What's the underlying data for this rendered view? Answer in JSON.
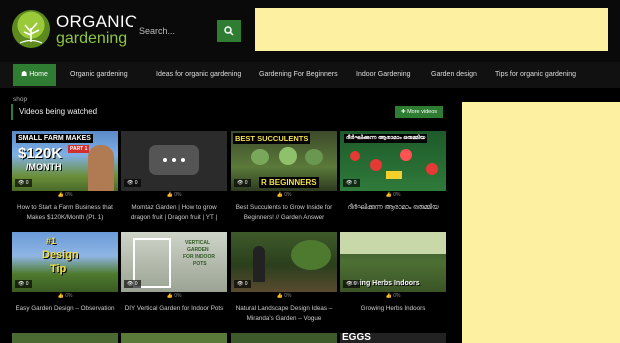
{
  "brand": {
    "line1": "ORGANIC",
    "line2": "gardening"
  },
  "search": {
    "placeholder": "Search..."
  },
  "nav": {
    "items": [
      {
        "label": "Home"
      },
      {
        "label": "Organic gardening"
      },
      {
        "label": "Ideas for organic gardening"
      },
      {
        "label": "Gardening For Beginners"
      },
      {
        "label": "Indoor Gardening"
      },
      {
        "label": "Garden design"
      },
      {
        "label": "Tips for organic gardening"
      }
    ]
  },
  "breadcrumb": "shop",
  "section": {
    "title": "Videos being watched",
    "more_label": "More videos"
  },
  "videos": [
    {
      "title": "How to Start a Farm Business that Makes $120K/Month (Pt. 1)",
      "views": "0",
      "rating": "0%",
      "overlay1": "SMALL FARM MAKES",
      "overlay2": "$120K",
      "overlay3": "/MONTH",
      "overlay4": "PART 1"
    },
    {
      "title": "Momtaz Garden | How to grow dragon fruit | Dragon fruit | YT |",
      "views": "0",
      "rating": "0%"
    },
    {
      "title": "Best Succulents to Grow Inside for Beginners! // Garden Answer",
      "views": "0",
      "rating": "0%",
      "overlay1": "BEST SUCCULENTS",
      "overlay2": "R BEGINNERS"
    },
    {
      "title": "ദീർഘിക്കുന്ന ആരാമാം ഒരുമ്മിയ",
      "views": "0",
      "rating": "0%",
      "overlay1": "ദീർഘിക്കുന്ന ആരാമാം ഒരുമ്മിയ"
    },
    {
      "title": "Easy Garden Design – Observation",
      "views": "0",
      "rating": "0%",
      "overlay1": "#1",
      "overlay2": "Design",
      "overlay3": "Tip"
    },
    {
      "title": "DIY Vertical Garden for Indoor Pots",
      "views": "0",
      "rating": "0%",
      "overlay1": "VERTICAL",
      "overlay2": "GARDEN",
      "overlay3": "FOR INDOOR",
      "overlay4": "POTS"
    },
    {
      "title": "Natural Landscape Design Ideas – Miranda's Garden – Vogue",
      "views": "0",
      "rating": "0%"
    },
    {
      "title": "Growing Herbs Indoors",
      "views": "0",
      "rating": "0%",
      "overlay1": "owing Herbs Indoors"
    }
  ],
  "bottom_row": {
    "overlay": "EGGS"
  },
  "colors": {
    "accent": "#2e7d32",
    "ad": "#fdf0a0",
    "background": "#000000"
  }
}
